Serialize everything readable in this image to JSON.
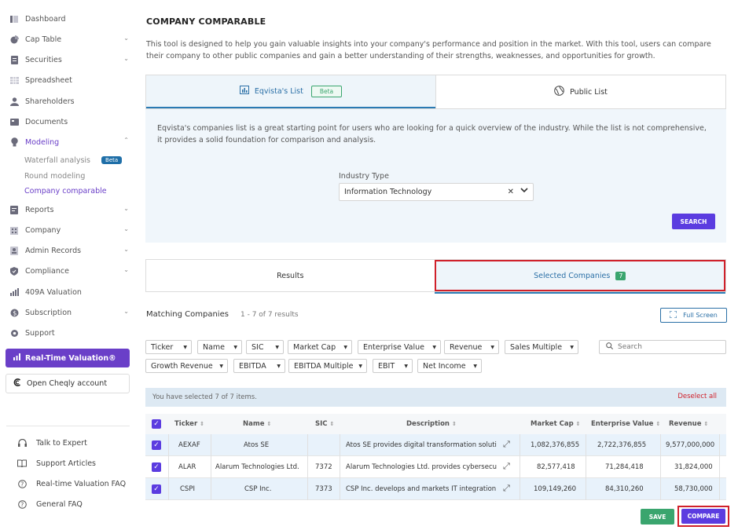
{
  "sidebar": {
    "items": [
      {
        "label": "Dashboard",
        "icon": "dashboard-icon"
      },
      {
        "label": "Cap Table",
        "icon": "pie-icon"
      },
      {
        "label": "Securities",
        "icon": "document-icon"
      },
      {
        "label": "Spreadsheet",
        "icon": "grid-icon"
      },
      {
        "label": "Shareholders",
        "icon": "user-icon"
      },
      {
        "label": "Documents",
        "icon": "folder-icon"
      },
      {
        "label": "Modeling",
        "icon": "bulb-icon"
      },
      {
        "label": "Reports",
        "icon": "report-icon"
      },
      {
        "label": "Company",
        "icon": "building-icon"
      },
      {
        "label": "Admin Records",
        "icon": "admin-icon"
      },
      {
        "label": "Compliance",
        "icon": "shield-icon"
      },
      {
        "label": "409A Valuation",
        "icon": "chart-icon"
      },
      {
        "label": "Subscription",
        "icon": "subscription-icon"
      },
      {
        "label": "Support",
        "icon": "gear-icon"
      }
    ],
    "modeling_sub": [
      {
        "label": "Waterfall analysis",
        "badge": "Beta"
      },
      {
        "label": "Round modeling"
      },
      {
        "label": "Company comparable"
      }
    ],
    "rtv_label": "Real-Time Valuation®",
    "cheqly_label": "Open Cheqly account",
    "help": [
      {
        "label": "Talk to Expert"
      },
      {
        "label": "Support Articles"
      },
      {
        "label": "Real-time Valuation FAQ"
      },
      {
        "label": "General FAQ"
      }
    ]
  },
  "main": {
    "title": "COMPANY COMPARABLE",
    "intro": "This tool is designed to help you gain valuable insights into your company's performance and position in the market. With this tool, users can compare their company to other public companies and gain a better understanding of their strengths, weaknesses, and opportunities for growth.",
    "tabs": [
      {
        "label": "Eqvista's List",
        "badge": "Beta"
      },
      {
        "label": "Public List"
      }
    ],
    "panel_text": "Eqvista's companies list is a great starting point for users who are looking for a quick overview of the industry. While the list is not comprehensive, it provides a solid foundation for comparison and analysis.",
    "industry_label": "Industry Type",
    "industry_value": "Information Technology",
    "search_btn": "SEARCH",
    "result_tabs": [
      {
        "label": "Results"
      },
      {
        "label": "Selected Companies",
        "count": "7"
      }
    ],
    "matching_title": "Matching Companies",
    "matching_count": "1 - 7 of 7 results",
    "fullscreen": "Full Screen",
    "filters": [
      "Ticker",
      "Name",
      "SIC",
      "Market Cap",
      "Enterprise Value",
      "Revenue",
      "Sales Multiple",
      "Growth Revenue",
      "EBITDA",
      "EBITDA Multiple",
      "EBIT",
      "Net Income"
    ],
    "search_placeholder": "Search",
    "selected_text": "You have selected 7 of 7 items.",
    "deselect": "Deselect all",
    "columns": [
      "Ticker",
      "Name",
      "SIC",
      "Description",
      "Market Cap",
      "Enterprise Value",
      "Revenue"
    ],
    "rows": [
      {
        "ticker": "AEXAF",
        "name": "Atos SE",
        "sic": "",
        "desc": "Atos SE provides digital transformation soluti",
        "mcap": "1,082,376,855",
        "ev": "2,722,376,855",
        "rev": "9,577,000,000"
      },
      {
        "ticker": "ALAR",
        "name": "Alarum Technologies Ltd.",
        "sic": "7372",
        "desc": "Alarum Technologies Ltd. provides cybersecuri",
        "mcap": "82,577,418",
        "ev": "71,284,418",
        "rev": "31,824,000"
      },
      {
        "ticker": "CSPI",
        "name": "CSP Inc.",
        "sic": "7373",
        "desc": "CSP Inc. develops and markets IT integration",
        "mcap": "109,149,260",
        "ev": "84,310,260",
        "rev": "58,730,000"
      }
    ],
    "save_btn": "SAVE",
    "compare_btn": "COMPARE"
  }
}
